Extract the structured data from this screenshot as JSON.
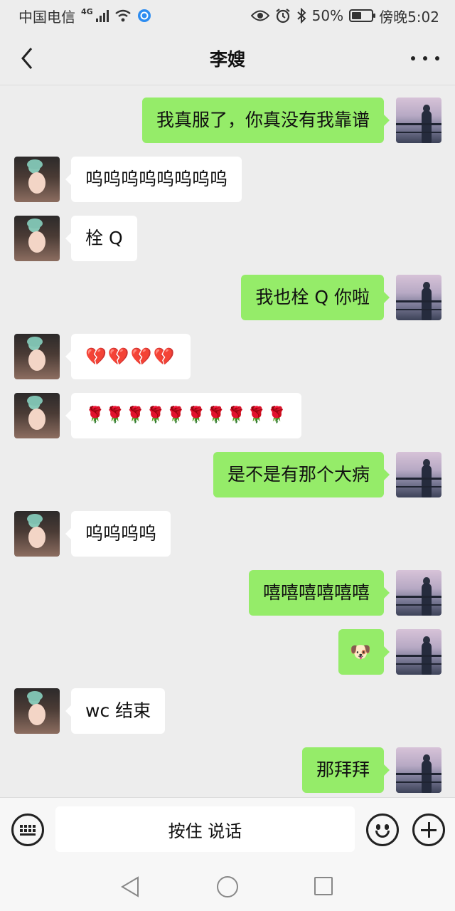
{
  "status_bar": {
    "carrier": "中国电信",
    "network": "4G",
    "battery": "50%",
    "battery_level": 0.5,
    "time": "傍晚5:02"
  },
  "header": {
    "title": "李嫂"
  },
  "messages": [
    {
      "side": "out",
      "text": "我真服了，你真没有我靠谱"
    },
    {
      "side": "in",
      "text": "呜呜呜呜呜呜呜呜"
    },
    {
      "side": "in",
      "text": "栓 Q"
    },
    {
      "side": "out",
      "text": "我也栓 Q 你啦"
    },
    {
      "side": "in",
      "text": "💔💔💔💔"
    },
    {
      "side": "in",
      "text": "🌹🌹🌹🌹🌹🌹🌹🌹🌹🌹"
    },
    {
      "side": "out",
      "text": "是不是有那个大病"
    },
    {
      "side": "in",
      "text": "呜呜呜呜"
    },
    {
      "side": "out",
      "text": "嘻嘻嘻嘻嘻嘻"
    },
    {
      "side": "out",
      "text": "🐶"
    },
    {
      "side": "in",
      "text": "wc 结束"
    },
    {
      "side": "out",
      "text": "那拜拜"
    }
  ],
  "input_bar": {
    "hold_to_talk_label": "按住 说话"
  },
  "colors": {
    "outgoing_bubble": "#95ec69",
    "incoming_bubble": "#ffffff",
    "background": "#ededed"
  },
  "icons": [
    "back-arrow-icon",
    "more-icon",
    "keyboard-voice-icon",
    "emoji-icon",
    "plus-icon",
    "eye-icon",
    "alarm-icon",
    "bluetooth-icon",
    "wifi-icon",
    "signal-icon",
    "battery-icon"
  ]
}
